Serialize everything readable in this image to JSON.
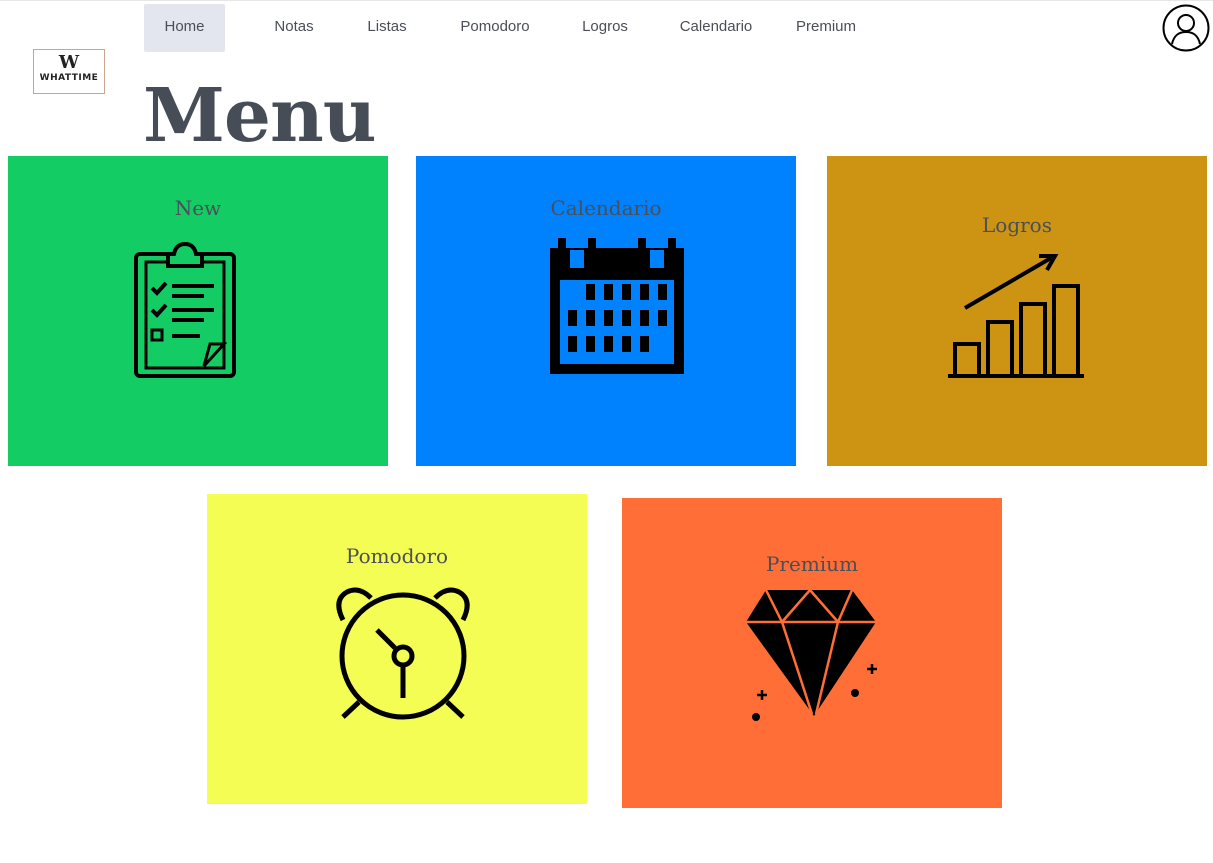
{
  "brand": {
    "logo_letter": "W",
    "logo_text": "WHATTIME"
  },
  "nav": {
    "items": [
      {
        "label": "Home",
        "active": true
      },
      {
        "label": "Notas"
      },
      {
        "label": "Listas"
      },
      {
        "label": "Pomodoro"
      },
      {
        "label": "Logros"
      },
      {
        "label": "Calendario"
      },
      {
        "label": "Premium"
      }
    ]
  },
  "page": {
    "title": "Menu"
  },
  "user": {
    "avatar_icon": "user-avatar-icon"
  },
  "cards": [
    {
      "label": "New",
      "color": "#13cc63",
      "icon": "clipboard-checklist-icon"
    },
    {
      "label": "Calendario",
      "color": "#0082ff",
      "icon": "calendar-icon"
    },
    {
      "label": "Logros",
      "color": "#cc9412",
      "icon": "growth-chart-icon"
    },
    {
      "label": "Pomodoro",
      "color": "#f4fd54",
      "icon": "alarm-clock-icon"
    },
    {
      "label": "Premium",
      "color": "#ff6e36",
      "icon": "diamond-icon"
    }
  ]
}
